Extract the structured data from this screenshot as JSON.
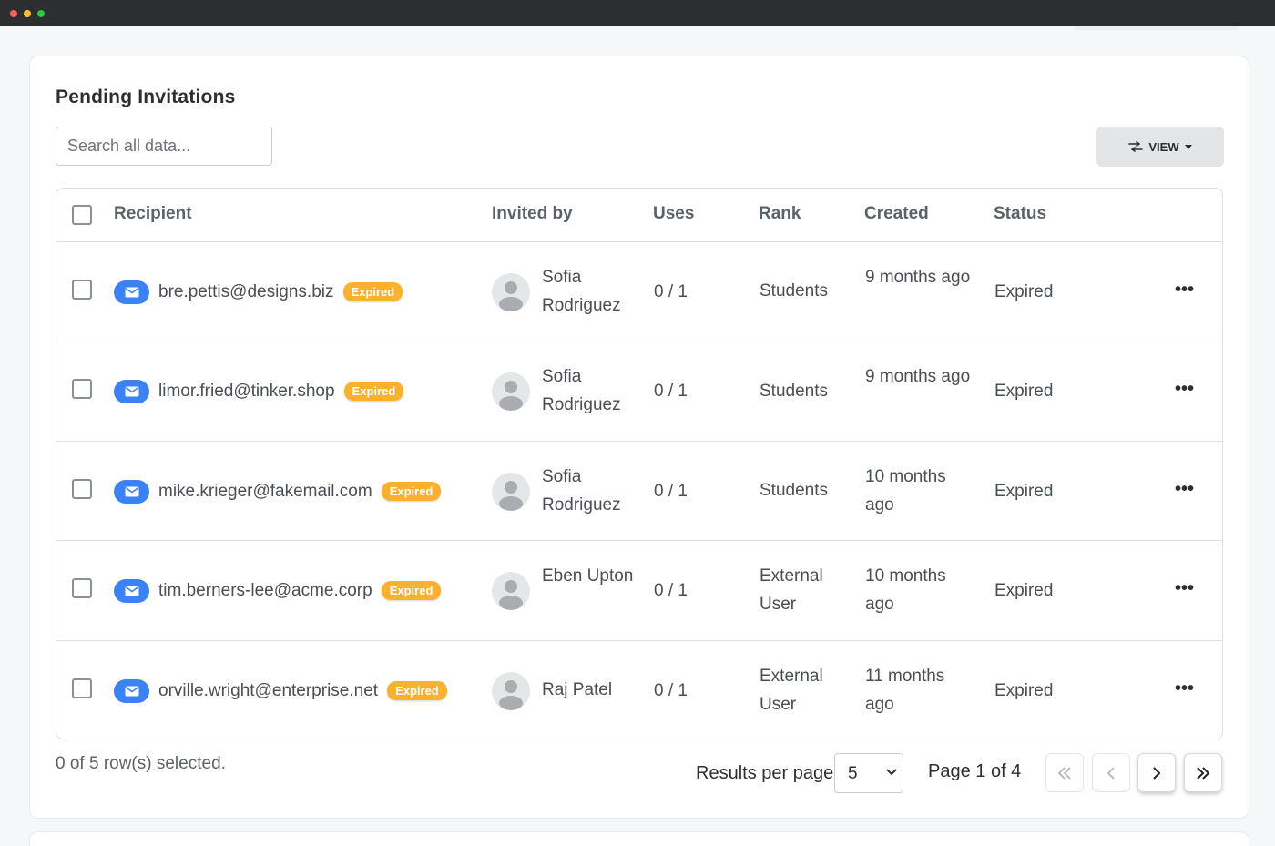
{
  "card": {
    "title": "Pending Invitations",
    "search_placeholder": "Search all data...",
    "view_label": "VIEW"
  },
  "table": {
    "headers": {
      "recipient": "Recipient",
      "invited_by": "Invited by",
      "uses": "Uses",
      "rank": "Rank",
      "created": "Created",
      "status": "Status"
    },
    "rows": [
      {
        "email": "bre.pettis@designs.biz",
        "badge": "Expired",
        "inviter": "Sofia Rodriguez",
        "uses": "0 / 1",
        "rank": "Students",
        "created": "9 months ago",
        "status": "Expired"
      },
      {
        "email": "limor.fried@tinker.shop",
        "badge": "Expired",
        "inviter": "Sofia Rodriguez",
        "uses": "0 / 1",
        "rank": "Students",
        "created": "9 months ago",
        "status": "Expired"
      },
      {
        "email": "mike.krieger@fakemail.com",
        "badge": "Expired",
        "inviter": "Sofia Rodriguez",
        "uses": "0 / 1",
        "rank": "Students",
        "created": "10 months ago",
        "status": "Expired"
      },
      {
        "email": "tim.berners-lee@acme.corp",
        "badge": "Expired",
        "inviter": "Eben Upton",
        "uses": "0 / 1",
        "rank": "External User",
        "created": "10 months ago",
        "status": "Expired"
      },
      {
        "email": "orville.wright@enterprise.net",
        "badge": "Expired",
        "inviter": "Raj Patel",
        "uses": "0 / 1",
        "rank": "External User",
        "created": "11 months ago",
        "status": "Expired"
      }
    ],
    "more_glyph": "•••"
  },
  "footer": {
    "selected_text": "0 of 5 row(s) selected.",
    "results_per_page_label": "Results per page",
    "results_per_page_value": "5",
    "page_info": "Page 1 of 4"
  },
  "colors": {
    "accent": "#3b82f6",
    "badge": "#fbb130"
  },
  "icons": {
    "mail": "mail-icon",
    "avatar": "user-avatar-icon",
    "view": "sliders-icon",
    "first": "chevron-double-left-icon",
    "prev": "chevron-left-icon",
    "next": "chevron-right-icon",
    "last": "chevron-double-right-icon"
  }
}
